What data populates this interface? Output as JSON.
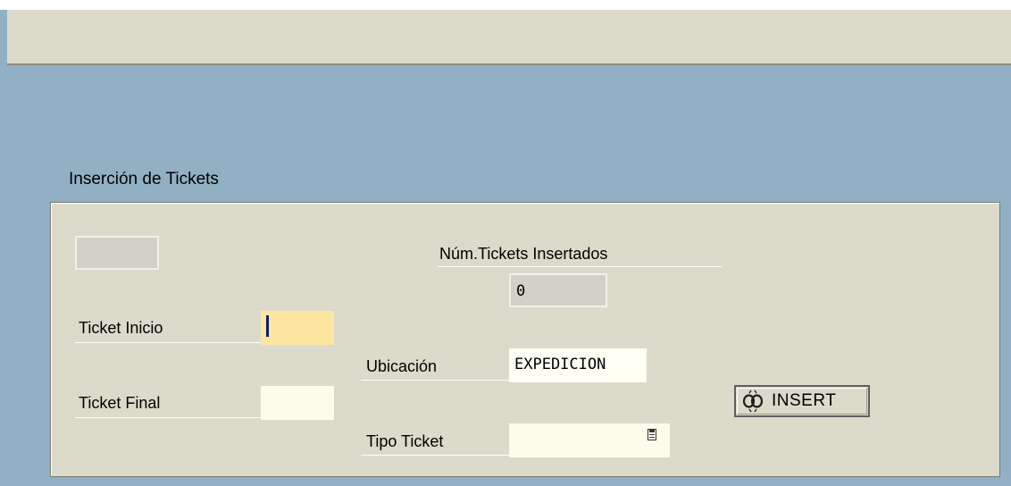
{
  "section": {
    "title": "Inserción de Tickets"
  },
  "counter": {
    "label": "Núm.Tickets Insertados",
    "value": "0"
  },
  "form": {
    "ticket_inicio": {
      "label": "Ticket Inicio",
      "value": ""
    },
    "ticket_final": {
      "label": "Ticket Final",
      "value": ""
    },
    "ubicacion": {
      "label": "Ubicación",
      "value": "EXPEDICION"
    },
    "tipo_ticket": {
      "label": "Tipo Ticket",
      "value": ""
    }
  },
  "actions": {
    "insert_label": "INSERT",
    "insert_icon": "chain-link-icon"
  },
  "colors": {
    "background": "#92b0c3",
    "panel": "#dcdacb",
    "active_field": "#fde7a0"
  }
}
